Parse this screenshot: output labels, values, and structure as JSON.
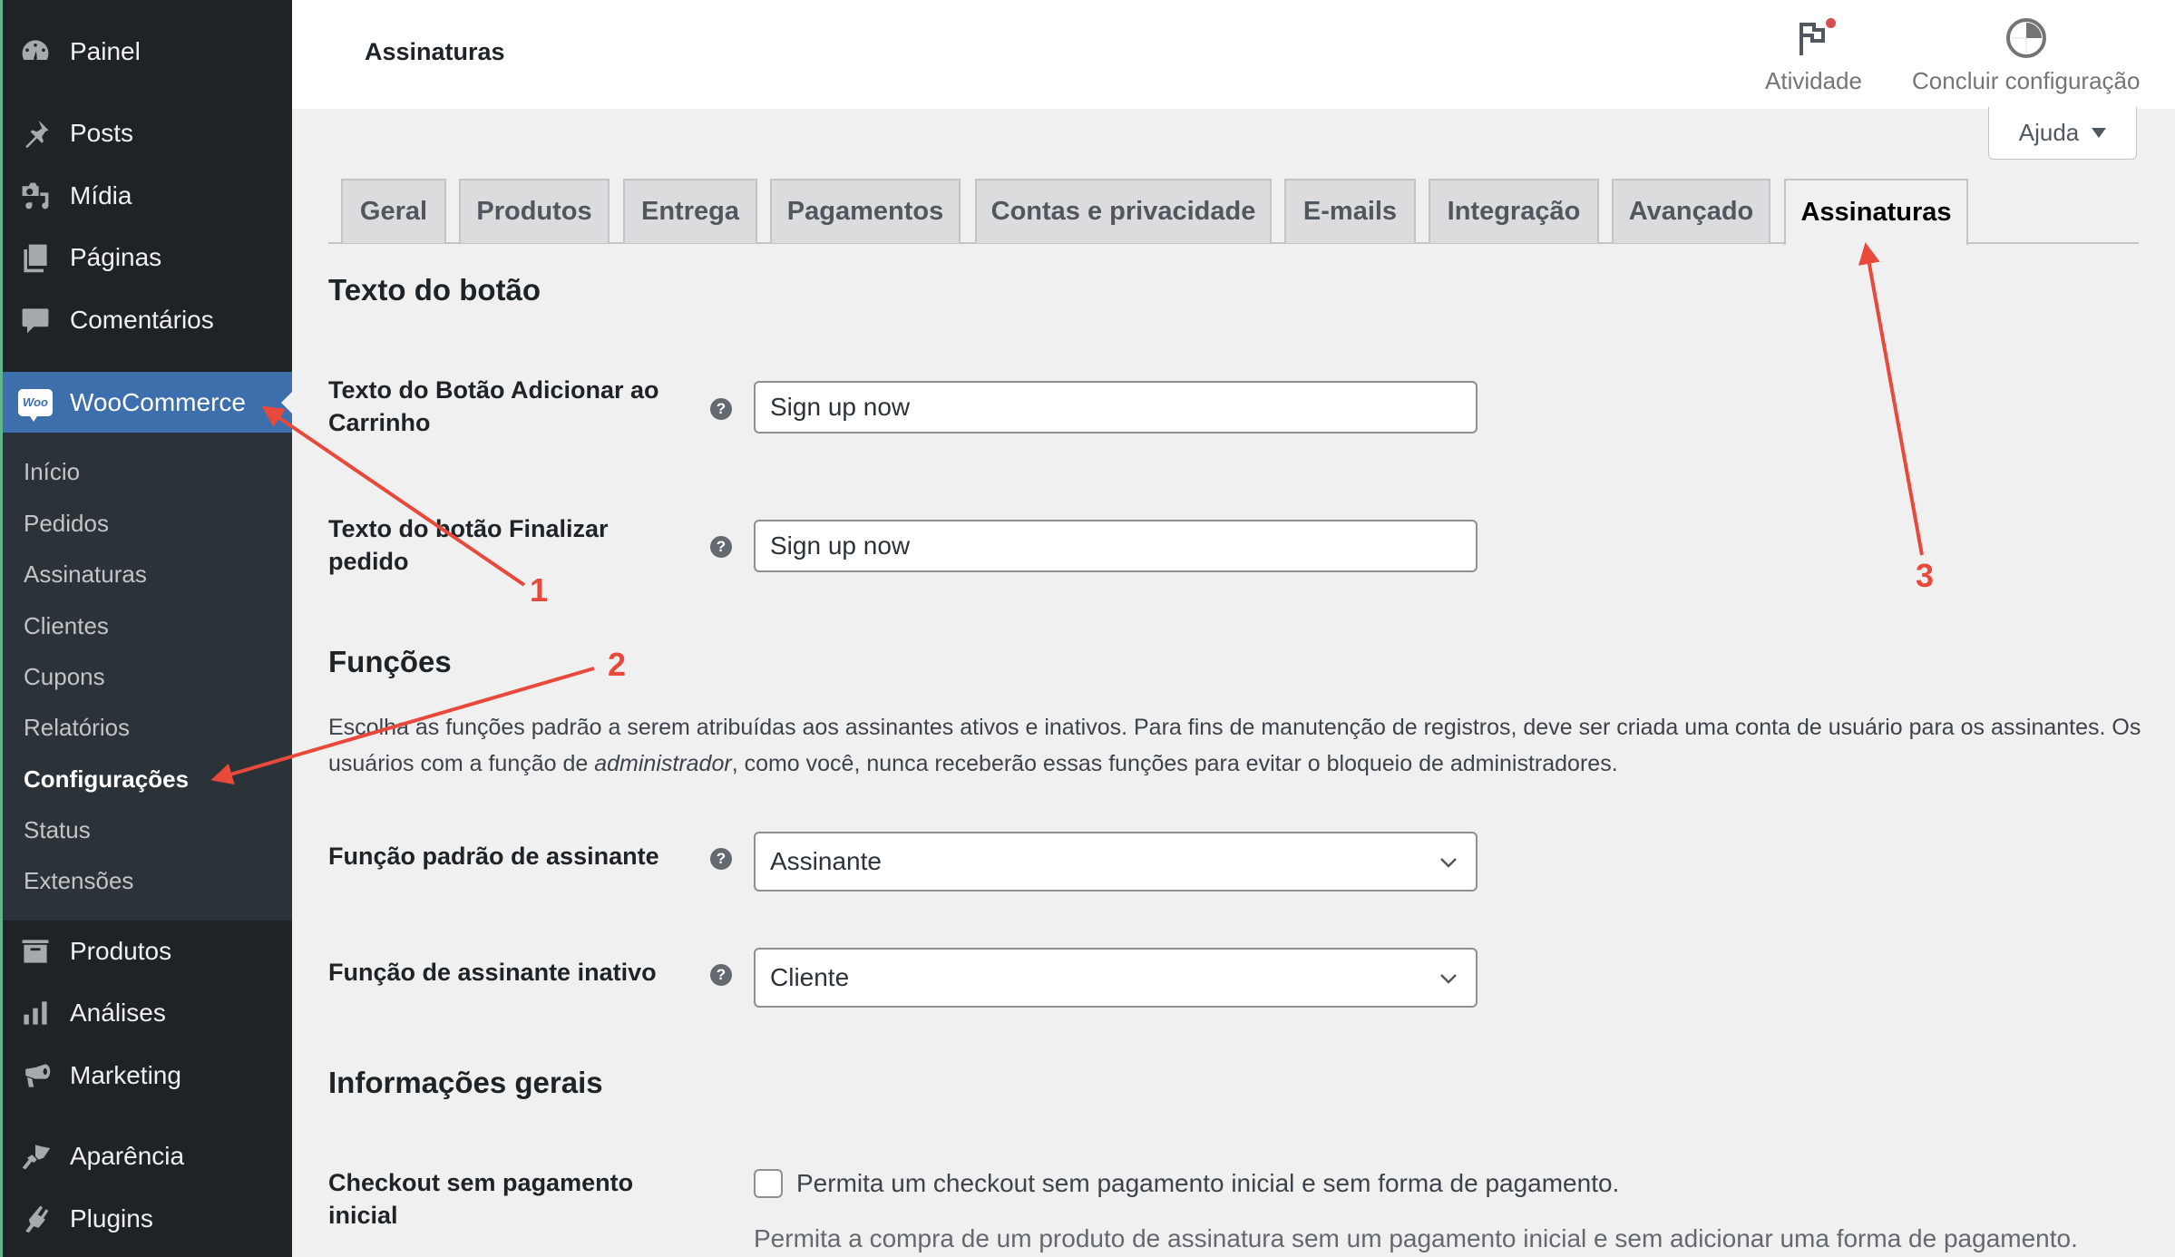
{
  "sidebar": {
    "top_items": [
      {
        "label": "Painel",
        "icon": "dashboard-icon"
      },
      {
        "label": "Posts",
        "icon": "pin-icon"
      },
      {
        "label": "Mídia",
        "icon": "media-icon"
      },
      {
        "label": "Páginas",
        "icon": "pages-icon"
      },
      {
        "label": "Comentários",
        "icon": "comments-icon"
      }
    ],
    "woocommerce": {
      "label": "WooCommerce",
      "badge": "Woo"
    },
    "submenu": [
      {
        "label": "Início"
      },
      {
        "label": "Pedidos"
      },
      {
        "label": "Assinaturas"
      },
      {
        "label": "Clientes"
      },
      {
        "label": "Cupons"
      },
      {
        "label": "Relatórios"
      },
      {
        "label": "Configurações",
        "current": true
      },
      {
        "label": "Status"
      },
      {
        "label": "Extensões"
      }
    ],
    "bottom_items": [
      {
        "label": "Produtos",
        "icon": "archive-icon"
      },
      {
        "label": "Análises",
        "icon": "bar-chart-icon"
      },
      {
        "label": "Marketing",
        "icon": "megaphone-icon"
      },
      {
        "label": "Aparência",
        "icon": "paintbrush-icon"
      },
      {
        "label": "Plugins",
        "icon": "plug-icon"
      }
    ]
  },
  "header": {
    "title": "Assinaturas",
    "activity_label": "Atividade",
    "setup_label": "Concluir configuração",
    "help_label": "Ajuda"
  },
  "tabs": [
    {
      "label": "Geral"
    },
    {
      "label": "Produtos"
    },
    {
      "label": "Entrega"
    },
    {
      "label": "Pagamentos"
    },
    {
      "label": "Contas e privacidade"
    },
    {
      "label": "E-mails"
    },
    {
      "label": "Integração"
    },
    {
      "label": "Avançado"
    },
    {
      "label": "Assinaturas",
      "active": true
    }
  ],
  "sections": {
    "button_text": {
      "title": "Texto do botão",
      "add_to_cart_label": "Texto do Botão Adicionar ao Carrinho",
      "add_to_cart_value": "Sign up now",
      "place_order_label": "Texto do botão Finalizar pedido",
      "place_order_value": "Sign up now"
    },
    "roles": {
      "title": "Funções",
      "description_part1": "Escolha as funções padrão a serem atribuídas aos assinantes ativos e inativos. Para fins de manutenção de registros, deve ser criada uma conta de usuário para os assinantes. Os usuários com a função de ",
      "description_em": "administrador",
      "description_part2": ", como você, nunca receberão essas funções para evitar o bloqueio de administradores.",
      "default_role_label": "Função padrão de assinante",
      "default_role_value": "Assinante",
      "inactive_role_label": "Função de assinante inativo",
      "inactive_role_value": "Cliente"
    },
    "general": {
      "title": "Informações gerais",
      "zero_checkout_label": "Checkout sem pagamento inicial",
      "zero_checkout_checkbox_label": "Permita um checkout sem pagamento inicial e sem forma de pagamento.",
      "zero_checkout_checked": false,
      "zero_checkout_description": "Permita a compra de um produto de assinatura sem um pagamento inicial e sem adicionar uma forma de pagamento."
    }
  },
  "help_icon_glyph": "?",
  "annotations": [
    {
      "number": "1",
      "target": "WooCommerce menu"
    },
    {
      "number": "2",
      "target": "Configurações submenu"
    },
    {
      "number": "3",
      "target": "Assinaturas tab"
    }
  ],
  "colors": {
    "sidebar_bg": "#1d2327",
    "submenu_bg": "#2c3338",
    "active_menu": "#3c6fab",
    "annotation_red": "#e9493a",
    "notification_dot": "#d94f4f"
  }
}
